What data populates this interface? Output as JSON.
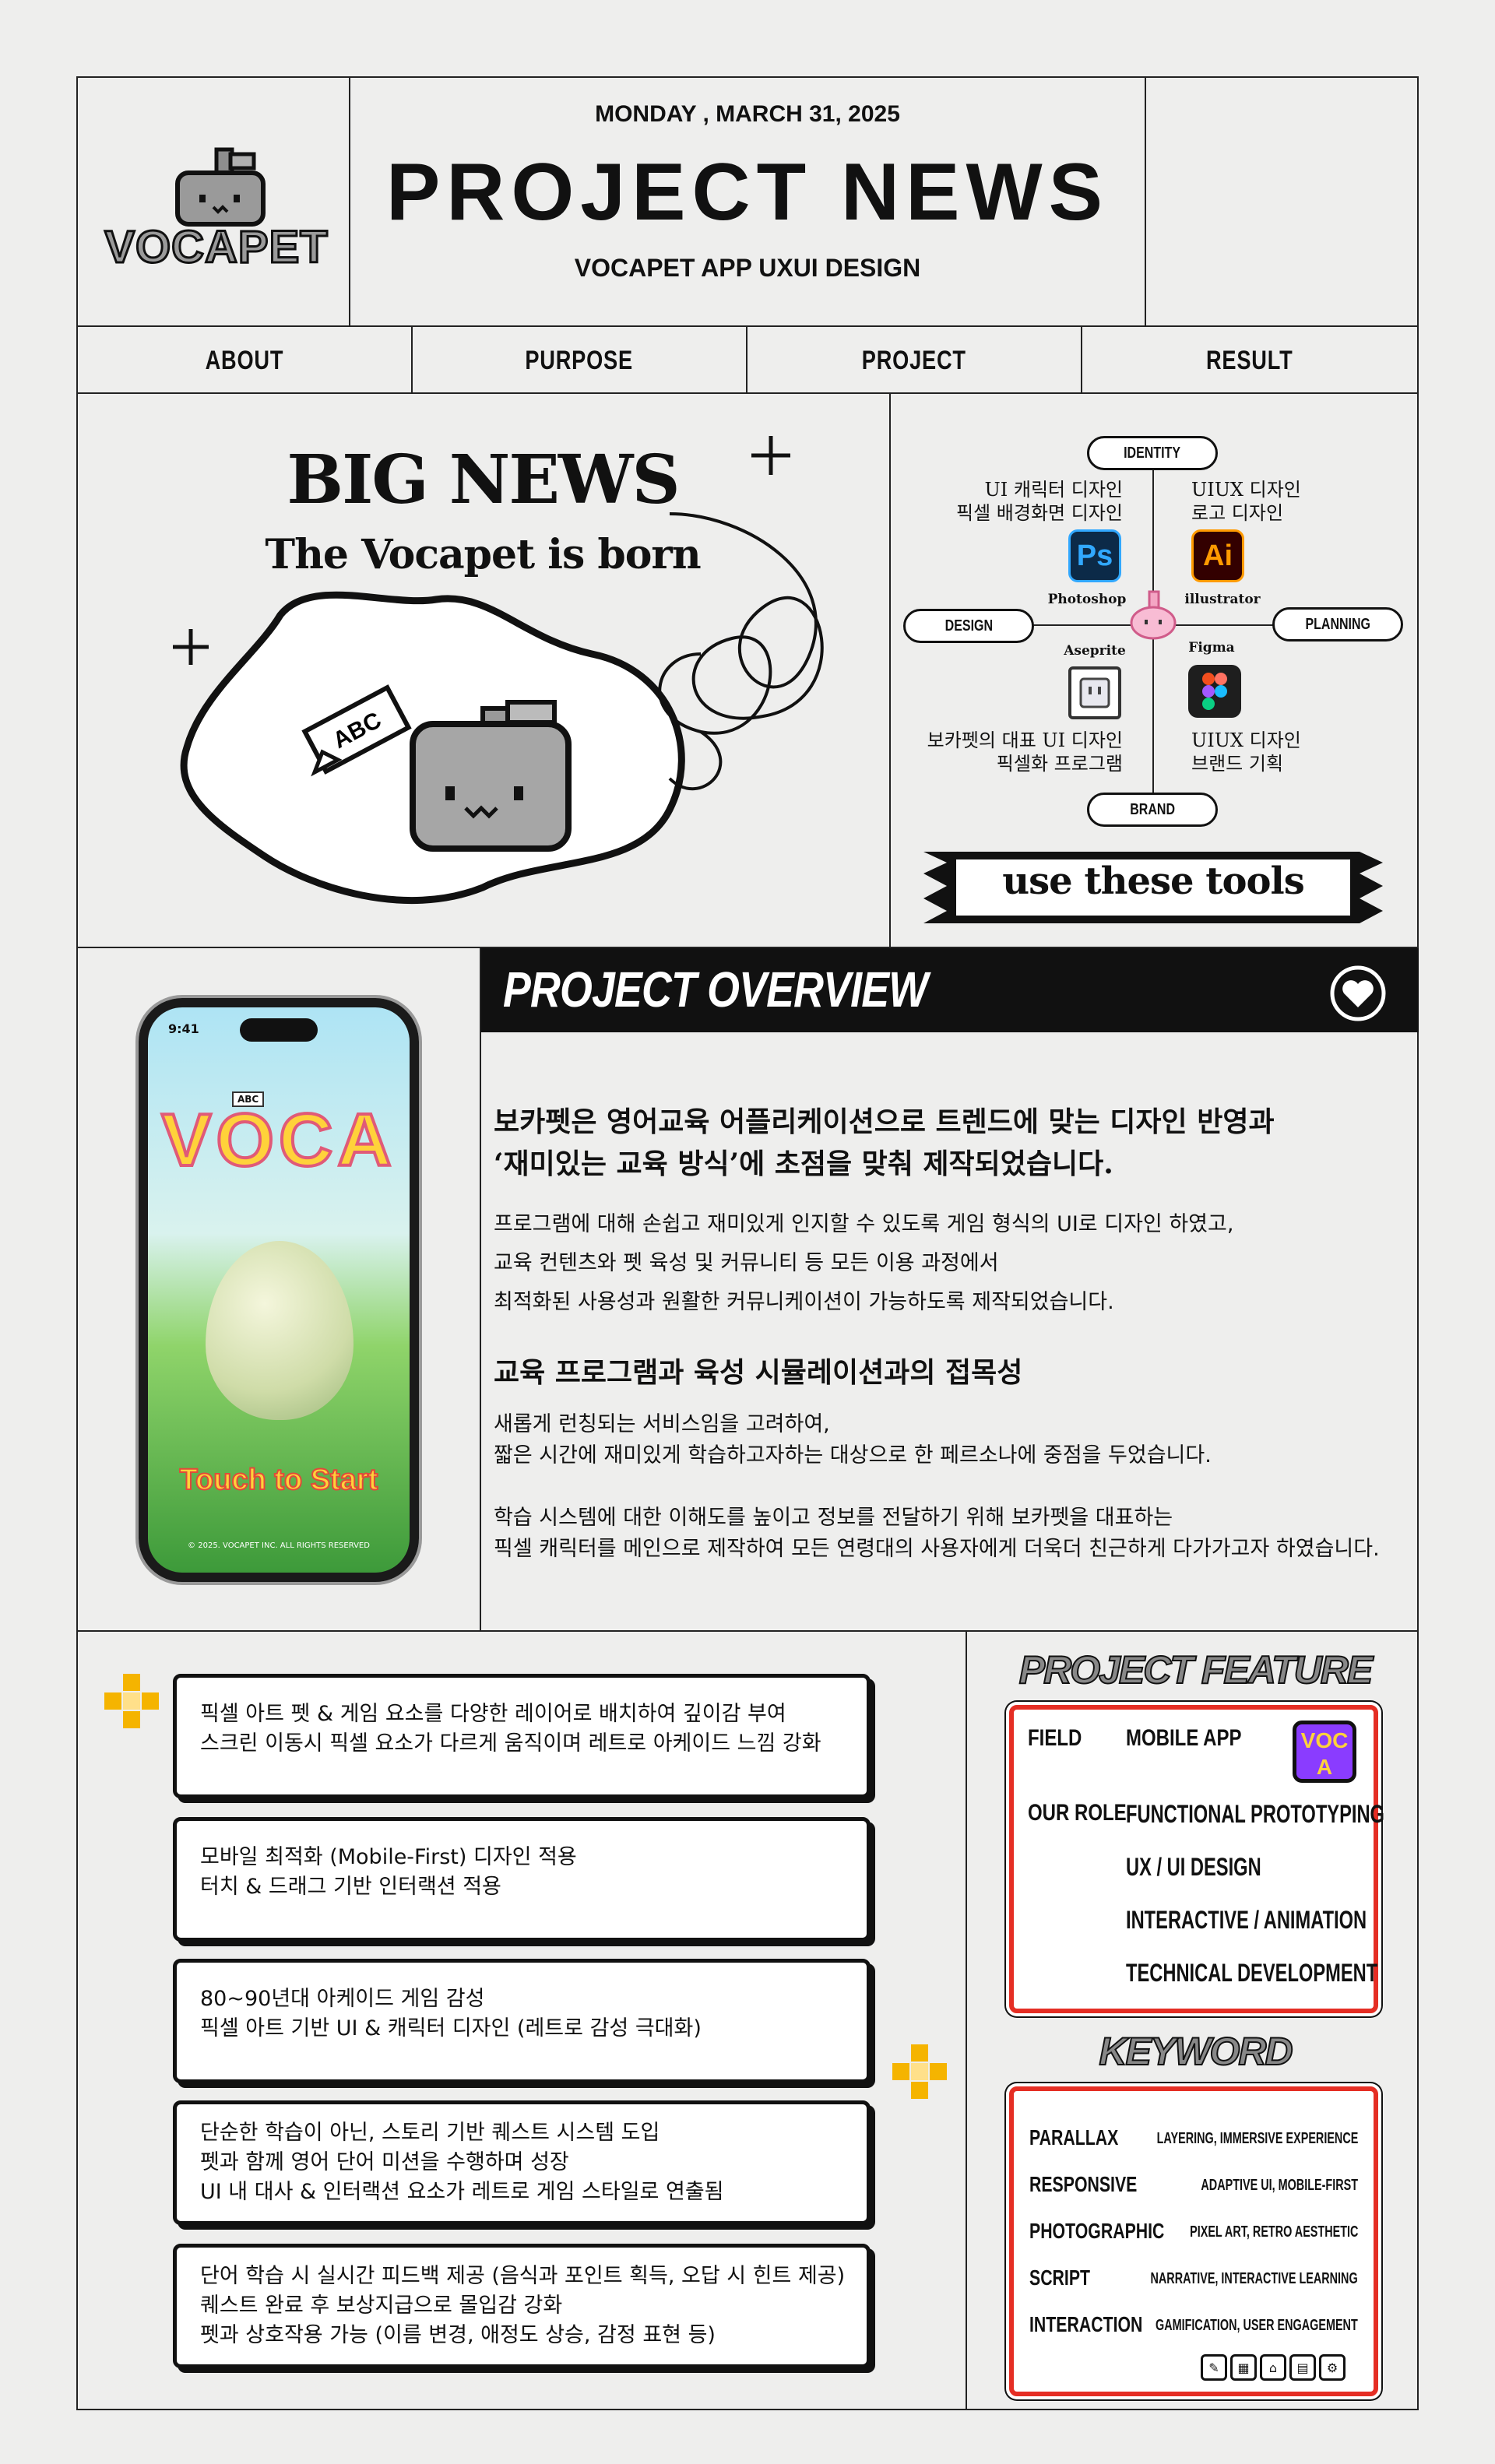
{
  "header": {
    "date": "MONDAY ,  MARCH 31, 2025",
    "title": "PROJECT NEWS",
    "subtitle": "VOCAPET APP UXUI DESIGN",
    "logo": "VOCAPET"
  },
  "nav": {
    "items": [
      "ABOUT",
      "PURPOSE",
      "PROJECT",
      "RESULT"
    ]
  },
  "hero": {
    "headline": "BIG NEWS",
    "tagline": "The Vocapet is born",
    "speech_bubble": "ABC"
  },
  "tools": {
    "nodes": {
      "identity": "IDENTITY",
      "design": "DESIGN",
      "planning": "PLANNING",
      "brand": "BRAND"
    },
    "desc_top_left": [
      "UI 캐릭터 디자인",
      "픽셀 배경화면 디자인"
    ],
    "desc_top_right": [
      "UIUX 디자인",
      "로고 디자인"
    ],
    "desc_bottom_left": [
      "보카펫의 대표 UI 디자인",
      "픽셀화 프로그램"
    ],
    "desc_bottom_right": [
      "UIUX 디자인",
      "브랜드 기획"
    ],
    "items": [
      {
        "label": "Photoshop",
        "glyph": "Ps",
        "color": "#0c2a48",
        "text_color": "#31a8ff"
      },
      {
        "label": "illustrator",
        "glyph": "Ai",
        "color": "#330000",
        "text_color": "#ff9a00"
      },
      {
        "label": "Aseprite",
        "glyph": "",
        "color": "#ffffff",
        "text_color": "#222222"
      },
      {
        "label": "Figma",
        "glyph": "",
        "color": "#1e1e1e",
        "text_color": "#ffffff"
      }
    ],
    "banner": "use these tools"
  },
  "phone": {
    "time": "9:41",
    "app_title": "VOCA",
    "bubble": "ABC",
    "cta": "Touch to Start",
    "copyright": "© 2025. VOCAPET INC. ALL RIGHTS RESERVED"
  },
  "overview": {
    "title": "PROJECT OVERVIEW",
    "heading1": [
      "보카펫은 영어교육 어플리케이션으로 트렌드에 맞는 디자인 반영과",
      "‘재미있는 교육 방식’에 초점을 맞춰 제작되었습니다."
    ],
    "para1": [
      "프로그램에 대해 손쉽고 재미있게 인지할 수 있도록 게임 형식의 UI로 디자인 하였고,",
      "교육 컨텐츠와 펫 육성 및 커뮤니티 등 모든 이용 과정에서",
      "최적화된 사용성과 원활한 커뮤니케이션이 가능하도록 제작되었습니다."
    ],
    "heading2": "교육 프로그램과 육성 시뮬레이션과의 접목성",
    "para2": [
      "새롭게 런칭되는 서비스임을 고려하여,",
      "짧은 시간에 재미있게 학습하고자하는 대상으로 한 페르소나에 중점을 두었습니다."
    ],
    "para3": [
      "학습 시스템에 대한 이해도를 높이고 정보를 전달하기 위해 보카펫을 대표하는",
      "픽셀 캐릭터를 메인으로 제작하여 모든 연령대의 사용자에게 더욱더 친근하게 다가가고자 하였습니다."
    ]
  },
  "cards": [
    [
      "픽셀 아트 펫 & 게임 요소를 다양한 레이어로 배치하여 깊이감 부여",
      "스크린 이동시 픽셀 요소가 다르게 움직이며 레트로 아케이드 느낌 강화"
    ],
    [
      "모바일 최적화 (Mobile-First) 디자인 적용",
      "터치 & 드래그 기반 인터랙션 적용"
    ],
    [
      "80~90년대 아케이드 게임 감성",
      "픽셀 아트 기반 UI & 캐릭터 디자인 (레트로 감성 극대화)"
    ],
    [
      "단순한 학습이 아닌, 스토리 기반 퀘스트 시스템 도입",
      "펫과 함께 영어 단어 미션을 수행하며 성장",
      "UI 내 대사 & 인터랙션 요소가 레트로 게임 스타일로 연출됨"
    ],
    [
      "단어 학습 시 실시간 피드백 제공 (음식과 포인트 획득, 오답 시 힌트 제공)",
      "퀘스트 완료 후 보상지급으로 몰입감 강화",
      "펫과 상호작용 가능 (이름 변경, 애정도 상승, 감정 표현 등)"
    ]
  ],
  "feature": {
    "title": "PROJECT FEATURE",
    "field_label": "FIELD",
    "field_value": "MOBILE APP",
    "badge": "VOCA",
    "role_label": "OUR ROLE",
    "roles": [
      "FUNCTIONAL PROTOTYPING",
      "UX / UI DESIGN",
      "INTERACTIVE / ANIMATION",
      "TECHNICAL DEVELOPMENT"
    ]
  },
  "keyword": {
    "title": "KEYWORD",
    "items": [
      {
        "name": "PARALLAX",
        "desc": "LAYERING, IMMERSIVE EXPERIENCE"
      },
      {
        "name": "RESPONSIVE",
        "desc": "ADAPTIVE UI, MOBILE-FIRST"
      },
      {
        "name": "PHOTOGRAPHIC",
        "desc": "PIXEL ART, RETRO AESTHETIC"
      },
      {
        "name": "SCRIPT",
        "desc": "NARRATIVE, INTERACTIVE LEARNING"
      },
      {
        "name": "INTERACTION",
        "desc": "GAMIFICATION, USER ENGAGEMENT"
      }
    ],
    "icons": [
      "pencil-icon",
      "calendar-icon",
      "home-icon",
      "chat-icon",
      "gear-icon"
    ]
  }
}
